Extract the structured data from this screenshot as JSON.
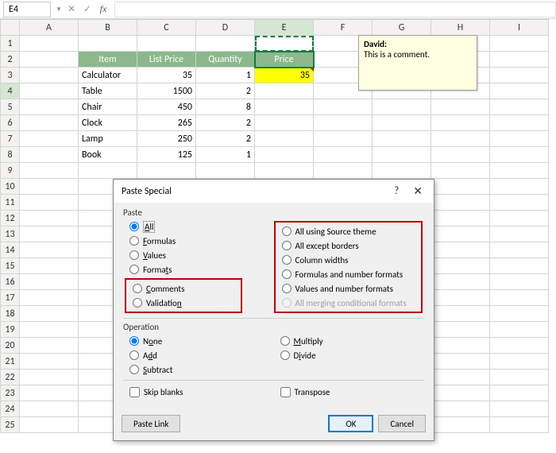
{
  "formula_bar": {
    "cell_ref": "E4",
    "fx": "fx",
    "value": ""
  },
  "columns": [
    "A",
    "B",
    "C",
    "D",
    "E",
    "F",
    "G",
    "H",
    "I"
  ],
  "rows_count": 25,
  "selected_col": "E",
  "selected_row": "4",
  "headers": {
    "item": "Item",
    "list_price": "List Price",
    "quantity": "Quantity",
    "price": "Price"
  },
  "data": [
    {
      "item": "Calculator",
      "list_price": "35",
      "quantity": "1",
      "price": "35"
    },
    {
      "item": "Table",
      "list_price": "1500",
      "quantity": "2",
      "price": ""
    },
    {
      "item": "Chair",
      "list_price": "450",
      "quantity": "8",
      "price": ""
    },
    {
      "item": "Clock",
      "list_price": "265",
      "quantity": "2",
      "price": ""
    },
    {
      "item": "Lamp",
      "list_price": "250",
      "quantity": "2",
      "price": ""
    },
    {
      "item": "Book",
      "list_price": "125",
      "quantity": "1",
      "price": ""
    }
  ],
  "comment": {
    "author": "David:",
    "text": "This is a comment."
  },
  "dialog": {
    "title": "Paste Special",
    "sections": {
      "paste": "Paste",
      "operation": "Operation"
    },
    "paste_left": {
      "all": "All",
      "formulas": "Formulas",
      "values": "Values",
      "formats": "Formats",
      "comments": "Comments",
      "validation": "Validation"
    },
    "paste_right": {
      "src_theme": "All using Source theme",
      "except_borders": "All except borders",
      "col_widths": "Column widths",
      "formulas_num": "Formulas and number formats",
      "values_num": "Values and number formats",
      "merge_cond": "All merging conditional formats"
    },
    "op": {
      "none": "None",
      "add": "Add",
      "subtract": "Subtract",
      "multiply": "Multiply",
      "divide": "Divide"
    },
    "checks": {
      "skip": "Skip blanks",
      "transpose": "Transpose"
    },
    "buttons": {
      "paste_link": "Paste Link",
      "ok": "OK",
      "cancel": "Cancel"
    }
  },
  "chart_data": {
    "type": "table",
    "title": "",
    "columns": [
      "Item",
      "List Price",
      "Quantity",
      "Price"
    ],
    "rows": [
      [
        "Calculator",
        35,
        1,
        35
      ],
      [
        "Table",
        1500,
        2,
        null
      ],
      [
        "Chair",
        450,
        8,
        null
      ],
      [
        "Clock",
        265,
        2,
        null
      ],
      [
        "Lamp",
        250,
        2,
        null
      ],
      [
        "Book",
        125,
        1,
        null
      ]
    ]
  }
}
